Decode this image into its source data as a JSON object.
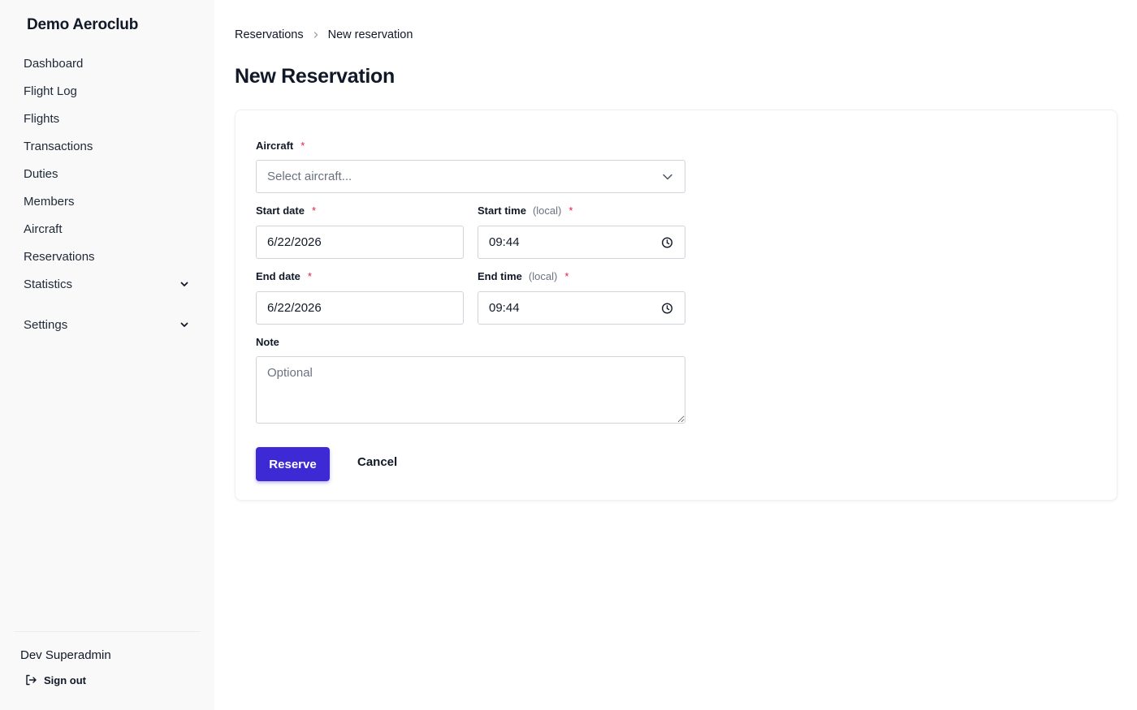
{
  "sidebar": {
    "brand": "Demo Aeroclub",
    "items": [
      {
        "label": "Dashboard"
      },
      {
        "label": "Flight Log"
      },
      {
        "label": "Flights"
      },
      {
        "label": "Transactions"
      },
      {
        "label": "Duties"
      },
      {
        "label": "Members"
      },
      {
        "label": "Aircraft"
      },
      {
        "label": "Reservations"
      },
      {
        "label": "Statistics"
      },
      {
        "label": "Settings"
      }
    ],
    "user_name": "Dev Superadmin",
    "sign_out": "Sign out"
  },
  "breadcrumb": {
    "parent": "Reservations",
    "current": "New reservation"
  },
  "page": {
    "title": "New Reservation"
  },
  "form": {
    "aircraft": {
      "label": "Aircraft",
      "required": "*",
      "placeholder": "Select aircraft..."
    },
    "start_date": {
      "label": "Start date",
      "required": "*",
      "value": "6/22/2026"
    },
    "start_time": {
      "label": "Start time",
      "hint": "(local)",
      "required": "*",
      "value": "09:44"
    },
    "end_date": {
      "label": "End date",
      "required": "*",
      "value": "6/22/2026"
    },
    "end_time": {
      "label": "End time",
      "hint": "(local)",
      "required": "*",
      "value": "09:44"
    },
    "note": {
      "label": "Note",
      "placeholder": "Optional"
    },
    "submit_label": "Reserve",
    "cancel_label": "Cancel"
  },
  "colors": {
    "primary": "#3d2ad4",
    "required": "#e11d48",
    "sidebar_bg": "#f9f9f9"
  }
}
